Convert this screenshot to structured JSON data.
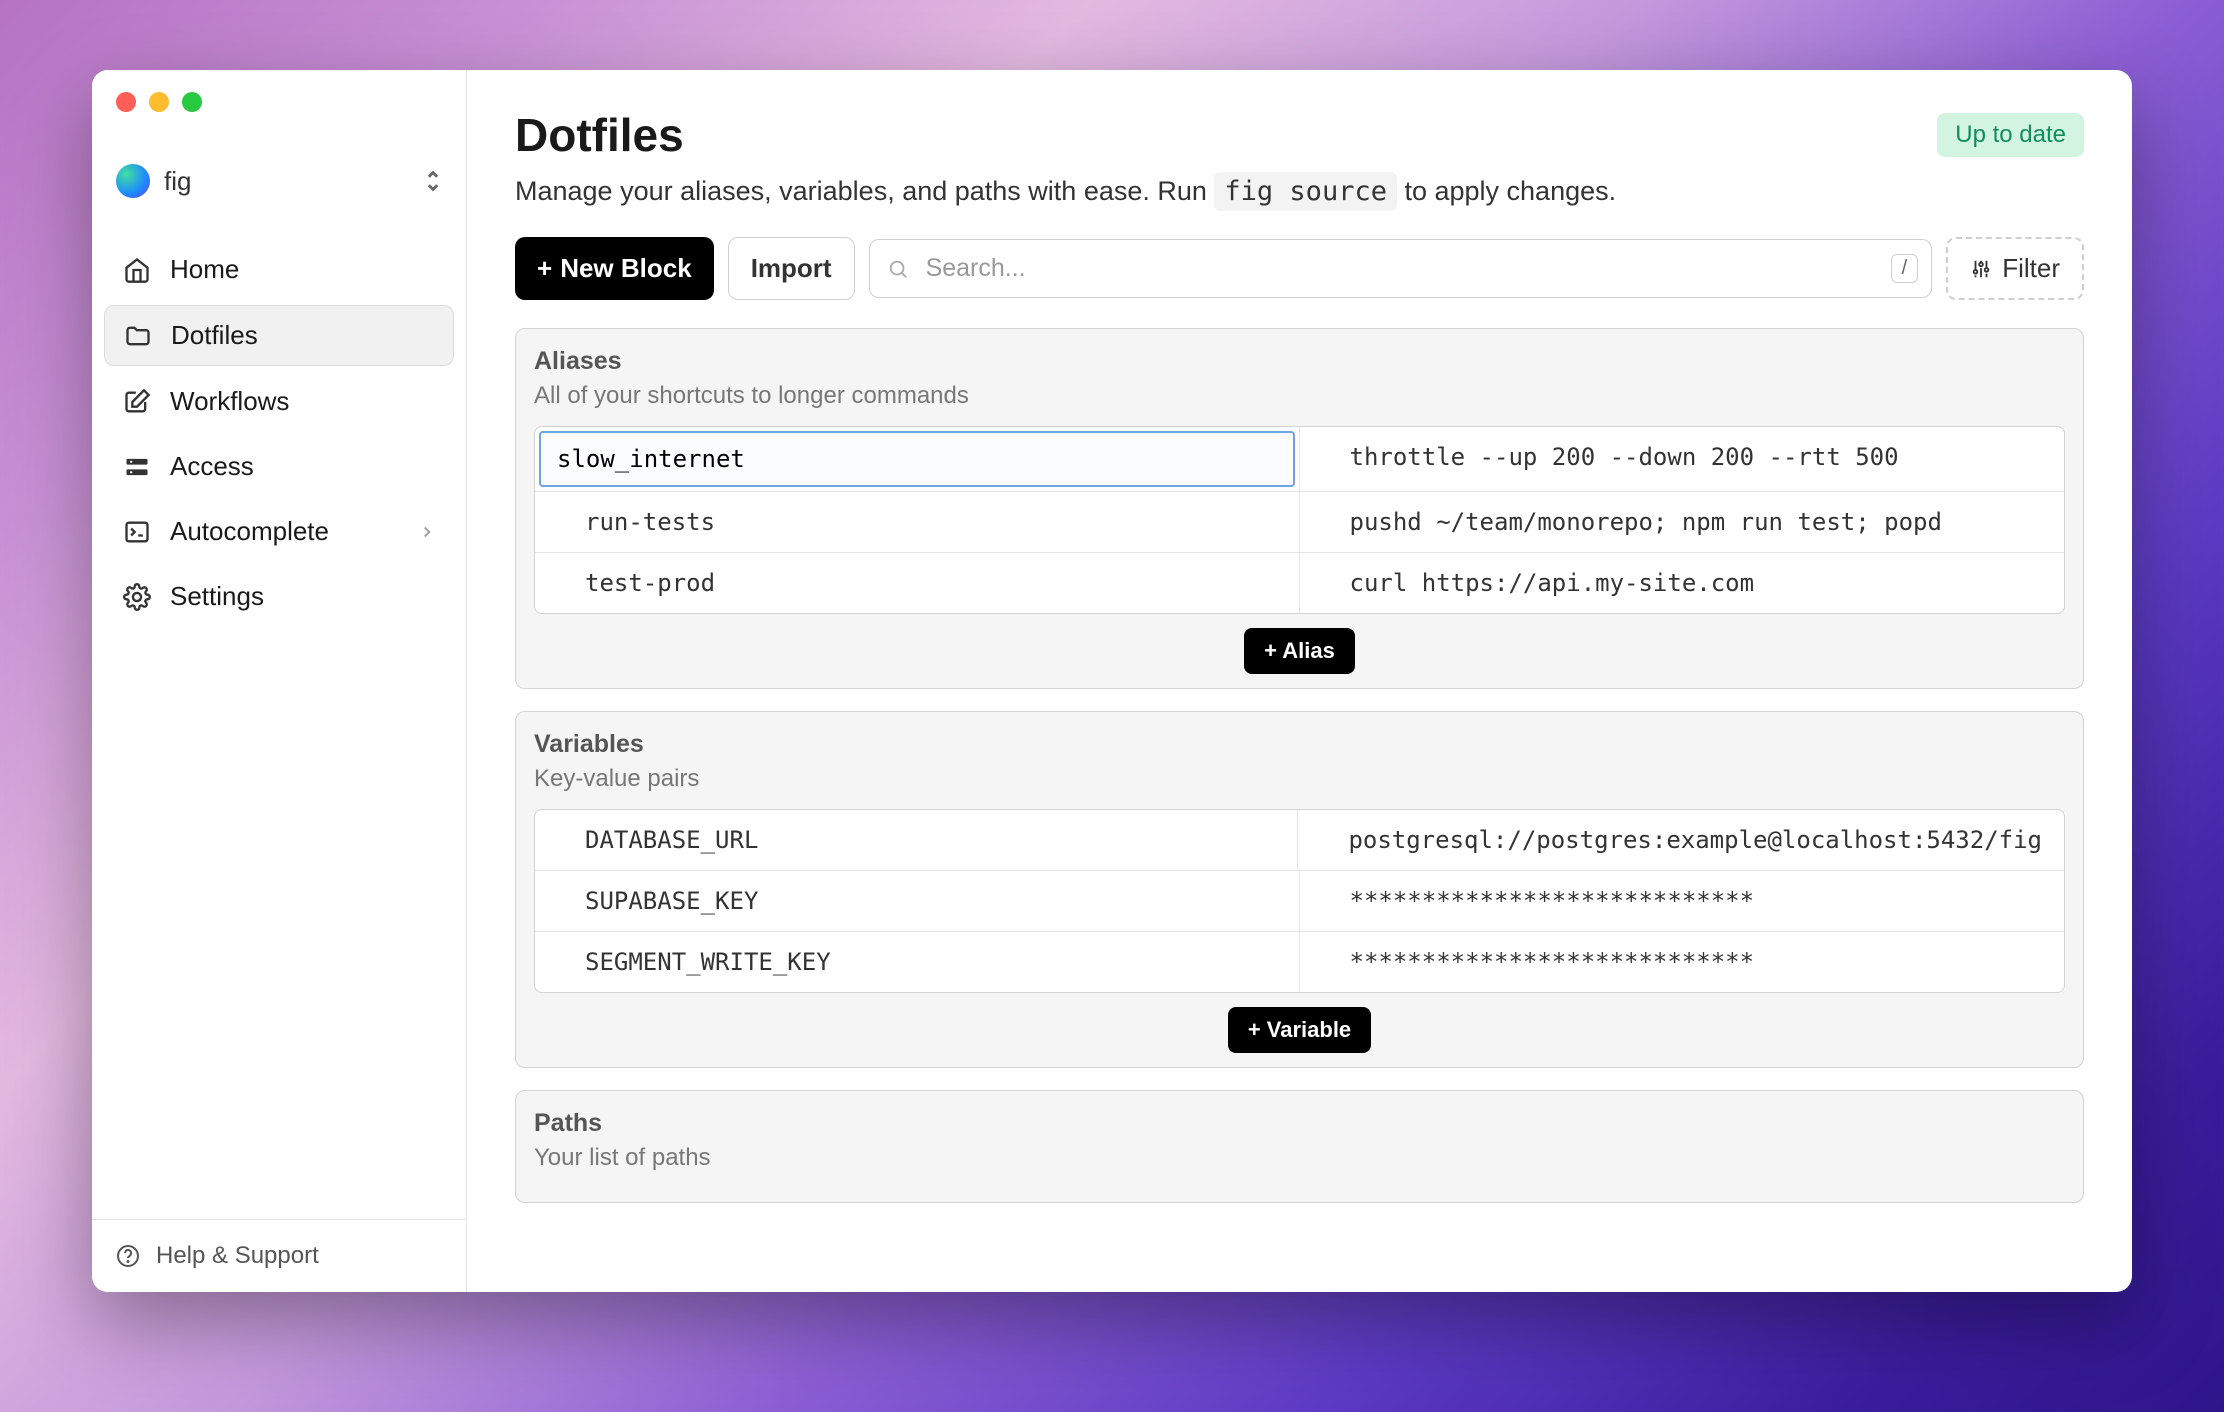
{
  "workspace": {
    "name": "fig"
  },
  "sidebar": {
    "items": [
      {
        "label": "Home"
      },
      {
        "label": "Dotfiles"
      },
      {
        "label": "Workflows"
      },
      {
        "label": "Access"
      },
      {
        "label": "Autocomplete"
      },
      {
        "label": "Settings"
      }
    ],
    "help": "Help & Support"
  },
  "header": {
    "title": "Dotfiles",
    "subtitle_pre": "Manage your aliases, variables, and paths with ease. Run ",
    "subtitle_code": "fig source",
    "subtitle_post": " to apply changes.",
    "status_badge": "Up to date"
  },
  "toolbar": {
    "new_block_label": "New Block",
    "import_label": "Import",
    "search_placeholder": "Search...",
    "search_kbd": "/",
    "filter_label": "Filter"
  },
  "sections": {
    "aliases": {
      "title": "Aliases",
      "subtitle": "All of your shortcuts to longer commands",
      "rows": [
        {
          "k": "slow_internet",
          "v": "throttle --up 200 --down 200 --rtt 500"
        },
        {
          "k": "run-tests",
          "v": "pushd ~/team/monorepo; npm run test; popd"
        },
        {
          "k": "test-prod",
          "v": "curl https://api.my-site.com"
        }
      ],
      "add_label": "+ Alias"
    },
    "variables": {
      "title": "Variables",
      "subtitle": "Key-value pairs",
      "rows": [
        {
          "k": "DATABASE_URL",
          "v": "postgresql://postgres:example@localhost:5432/fig"
        },
        {
          "k": "SUPABASE_KEY",
          "v": "****************************"
        },
        {
          "k": "SEGMENT_WRITE_KEY",
          "v": "****************************"
        }
      ],
      "add_label": "+ Variable"
    },
    "paths": {
      "title": "Paths",
      "subtitle": "Your list of paths"
    }
  }
}
